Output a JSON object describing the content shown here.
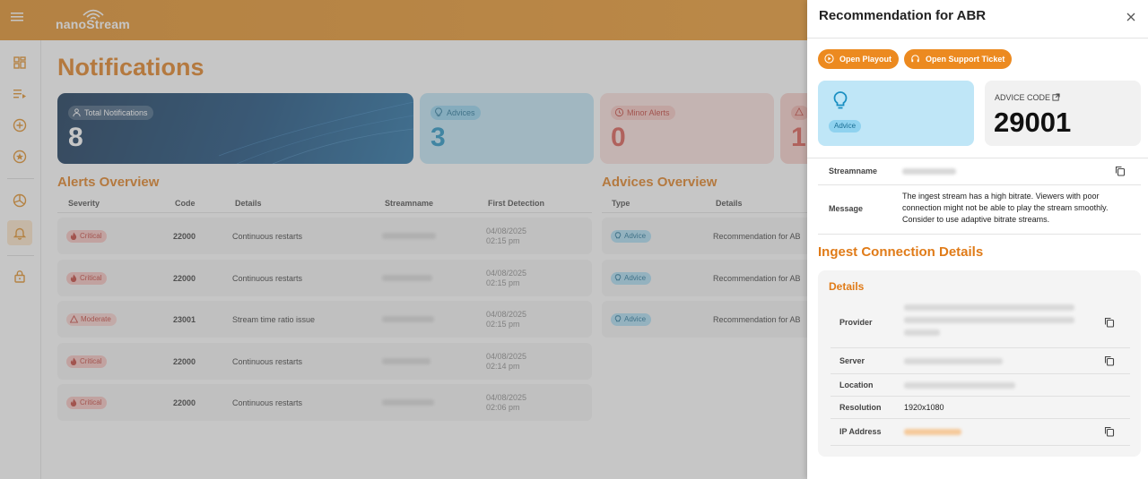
{
  "app": {
    "logo_text": "nanoStream"
  },
  "page": {
    "title": "Notifications"
  },
  "cards": {
    "total": {
      "label": "Total Notifications",
      "value": "8"
    },
    "advices": {
      "label": "Advices",
      "value": "3"
    },
    "minor": {
      "label": "Minor Alerts",
      "value": "0"
    },
    "major": {
      "value": "1"
    }
  },
  "alerts": {
    "title": "Alerts Overview",
    "headers": [
      "Severity",
      "Code",
      "Details",
      "Streamname",
      "First Detection"
    ],
    "rows": [
      {
        "severity": "Critical",
        "code": "22000",
        "details": "Continuous restarts",
        "date": "04/08/2025",
        "time": "02:15 pm"
      },
      {
        "severity": "Critical",
        "code": "22000",
        "details": "Continuous restarts",
        "date": "04/08/2025",
        "time": "02:15 pm"
      },
      {
        "severity": "Moderate",
        "code": "23001",
        "details": "Stream time ratio issue",
        "date": "04/08/2025",
        "time": "02:15 pm"
      },
      {
        "severity": "Critical",
        "code": "22000",
        "details": "Continuous restarts",
        "date": "04/08/2025",
        "time": "02:14 pm"
      },
      {
        "severity": "Critical",
        "code": "22000",
        "details": "Continuous restarts",
        "date": "04/08/2025",
        "time": "02:06 pm"
      }
    ]
  },
  "advices": {
    "title": "Advices Overview",
    "headers": [
      "Type",
      "Details"
    ],
    "rows": [
      {
        "type": "Advice",
        "details": "Recommendation for AB"
      },
      {
        "type": "Advice",
        "details": "Recommendation for AB"
      },
      {
        "type": "Advice",
        "details": "Recommendation for AB"
      }
    ]
  },
  "panel": {
    "title": "Recommendation for ABR",
    "open_playout": "Open Playout",
    "open_ticket": "Open Support Ticket",
    "advice_chip": "Advice",
    "code_label": "ADVICE CODE",
    "code_value": "29001",
    "streamname_label": "Streamname",
    "message_label": "Message",
    "message": "The ingest stream has a high bitrate. Viewers with poor connection might not be able to play the stream smoothly. Consider to use adaptive bitrate streams.",
    "ingest_title": "Ingest Connection Details",
    "details_title": "Details",
    "provider_label": "Provider",
    "server_label": "Server",
    "location_label": "Location",
    "resolution_label": "Resolution",
    "resolution_value": "1920x1080",
    "ip_label": "IP Address"
  },
  "colors": {
    "brand": "#e07b18",
    "header": "#f09a2a",
    "advice": "#bfe6f7",
    "critical": "#c23b32"
  }
}
